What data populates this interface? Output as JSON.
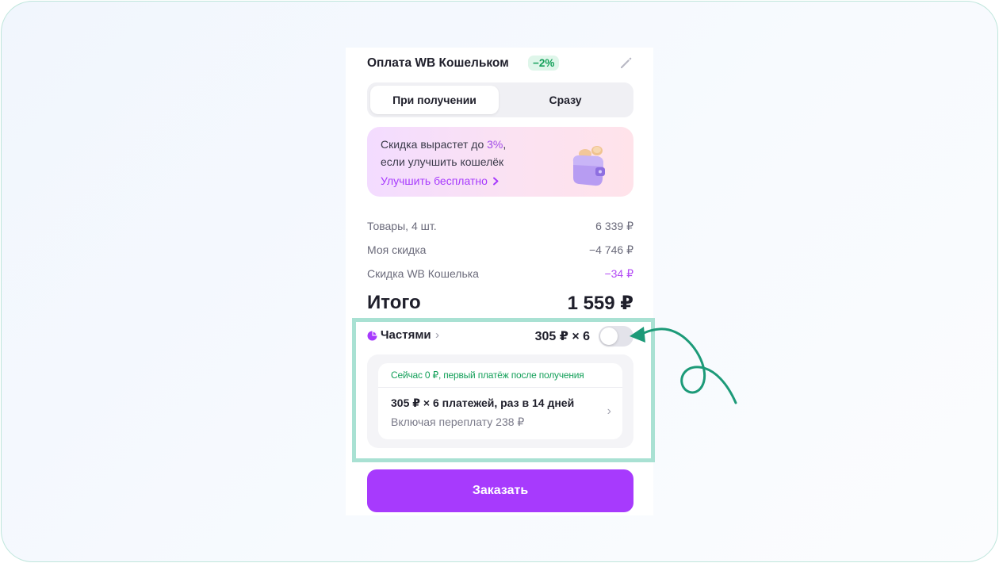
{
  "payment": {
    "title": "Оплата WB Кошельком",
    "discount_badge": "−2%",
    "edit_icon": "pencil-icon"
  },
  "tabs": [
    {
      "label": "При получении",
      "active": true
    },
    {
      "label": "Сразу",
      "active": false
    }
  ],
  "promo": {
    "line1_prefix": "Скидка вырастет до ",
    "line1_value": "3%",
    "line1_suffix": ",",
    "line2": "если улучшить кошелёк",
    "link": "Улучшить бесплатно",
    "link_icon": "chevron-right-icon",
    "art_icon": "wallet-coins-icon"
  },
  "summary": {
    "rows": [
      {
        "label": "Товары, 4 шт.",
        "value": "6 339 ₽"
      },
      {
        "label": "Моя скидка",
        "value": "−4 746 ₽"
      },
      {
        "label": "Скидка WB Кошелька",
        "value": "−34 ₽"
      }
    ],
    "total_label": "Итого",
    "total_value": "1 559 ₽"
  },
  "installments": {
    "label": "Частями",
    "chevron": "›",
    "amount": "305 ₽ × 6",
    "toggle_on": false,
    "note": "Сейчас 0 ₽, первый платёж после получения",
    "plan_main": "305 ₽ × 6 платежей, раз в 14 дней",
    "plan_sub": "Включая переплату 238 ₽",
    "plan_chevron": "›"
  },
  "order_button": "Заказать",
  "colors": {
    "accent": "#a73afd",
    "green": "#14a05a",
    "highlight": "#a9e1d3",
    "arrow": "#1c9a78"
  }
}
